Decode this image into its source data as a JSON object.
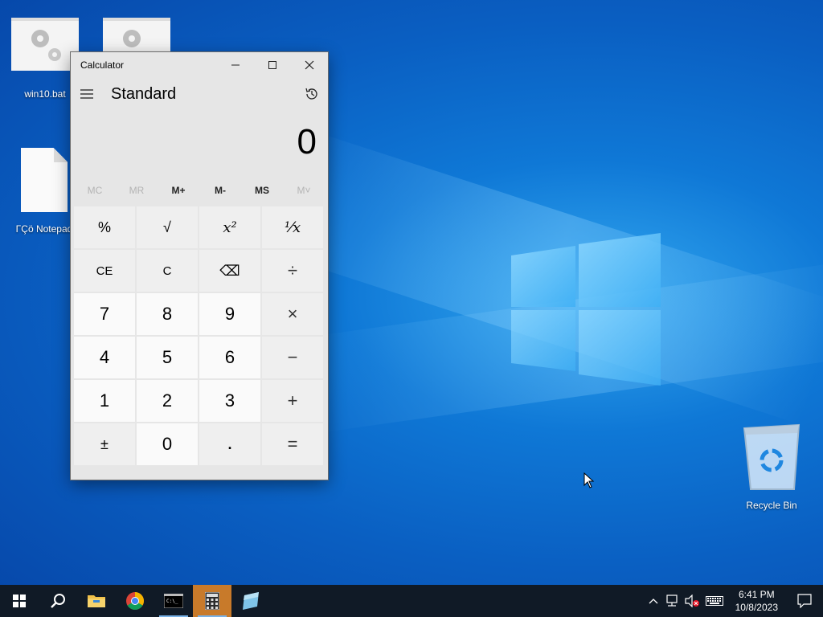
{
  "desktop": {
    "icons": [
      {
        "label": "win10.bat"
      },
      {
        "label": ""
      },
      {
        "label": "ΓÇö Notepad"
      },
      {
        "label": "Recycle Bin"
      }
    ]
  },
  "calculator": {
    "window_title": "Calculator",
    "mode": "Standard",
    "display_value": "0",
    "memory": [
      "MC",
      "MR",
      "M+",
      "M-",
      "MS",
      "M˅"
    ],
    "keys": [
      "%",
      "√",
      "x²",
      "¹⁄x",
      "CE",
      "C",
      "⌫",
      "÷",
      "7",
      "8",
      "9",
      "×",
      "4",
      "5",
      "6",
      "−",
      "1",
      "2",
      "3",
      "+",
      "±",
      "0",
      ".",
      "="
    ]
  },
  "taskbar": {
    "clock_time": "6:41 PM",
    "clock_date": "10/8/2023"
  },
  "colors": {
    "taskbar_bg": "#101a26",
    "active_app": "#c87a2a",
    "calc_bg": "#e6e6e6"
  }
}
